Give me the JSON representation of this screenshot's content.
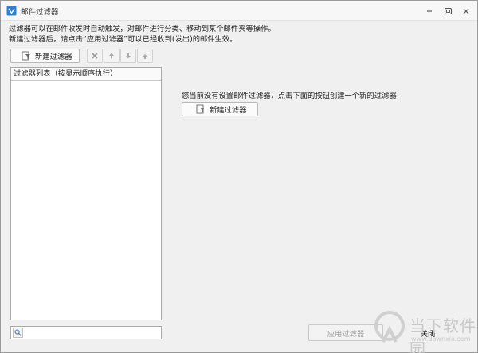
{
  "window": {
    "title": "邮件过滤器"
  },
  "info": {
    "line1": "过滤器可以在邮件收发时自动触发，对邮件进行分类、移动到某个邮件夹等操作。",
    "line2": "新建过滤器后，请点击“应用过滤器”可以已经收到(发出)的邮件生效。"
  },
  "toolbar": {
    "new_filter_label": "新建过滤器"
  },
  "list": {
    "header": "过滤器列表（按显示顺序执行）",
    "items": []
  },
  "main": {
    "empty_message": "您当前没有设置邮件过滤器，点击下面的按钮创建一个新的过滤器",
    "new_filter_label": "新建过滤器"
  },
  "search": {
    "value": "",
    "placeholder": ""
  },
  "footer": {
    "apply_label": "应用过滤器",
    "close_label": "关闭"
  },
  "watermark": {
    "text": "当下软件园",
    "url": "www.downxia.com"
  }
}
